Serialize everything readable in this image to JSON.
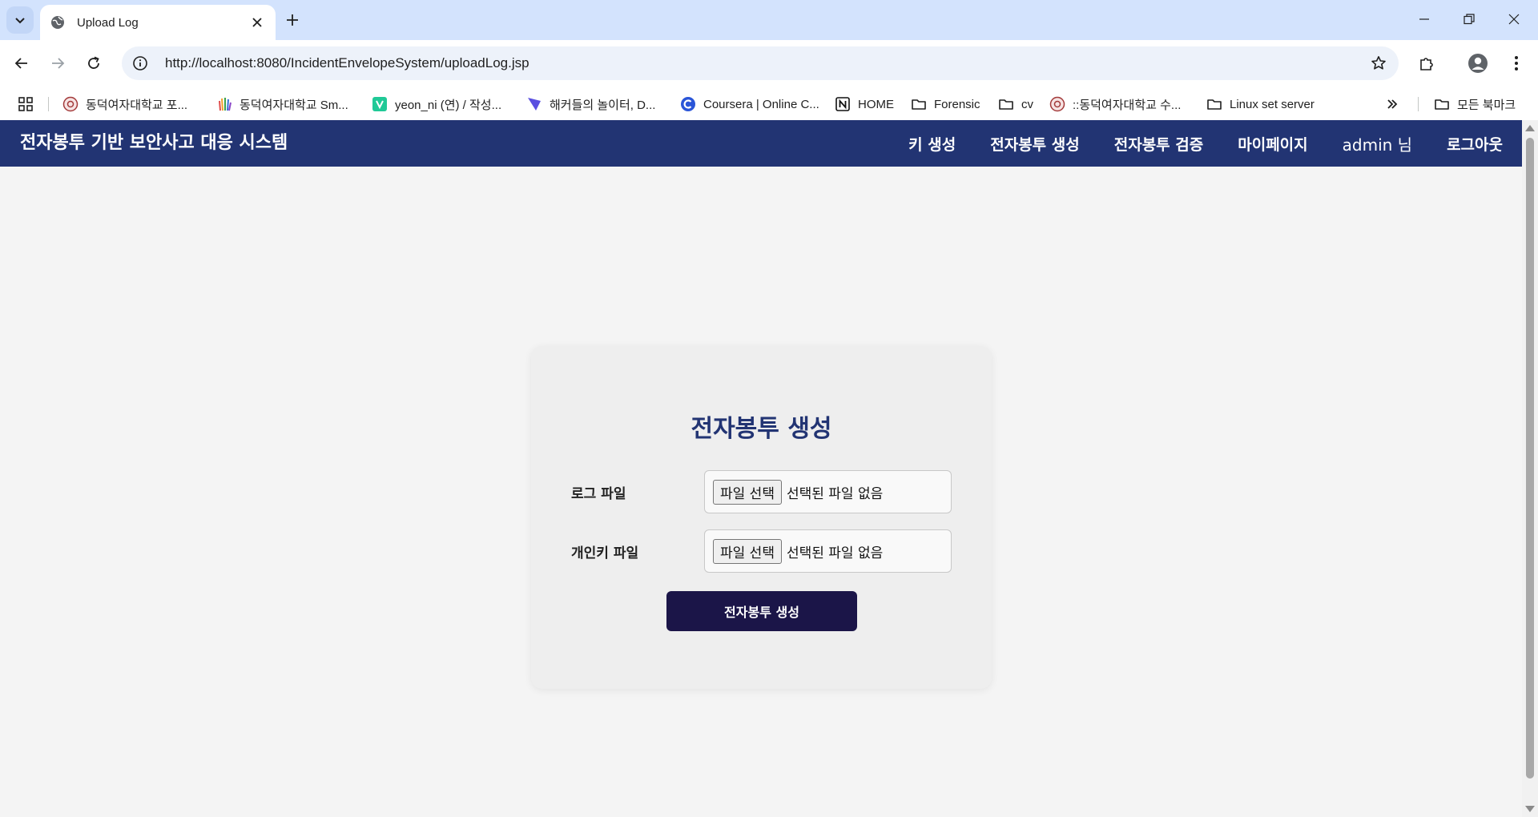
{
  "browser": {
    "tab_title": "Upload Log",
    "url": "http://localhost:8080/IncidentEnvelopeSystem/uploadLog.jsp",
    "bookmarks": [
      {
        "label": "동덕여자대학교 포...",
        "icon": "university-seal-icon"
      },
      {
        "label": "동덕여자대학교 Sm...",
        "icon": "hand-logo-icon"
      },
      {
        "label": "yeon_ni (연) / 작성...",
        "icon": "velog-icon"
      },
      {
        "label": "해커들의 놀이터, D...",
        "icon": "dreamhack-icon"
      },
      {
        "label": "Coursera | Online C...",
        "icon": "coursera-icon"
      },
      {
        "label": "HOME",
        "icon": "notion-icon"
      },
      {
        "label": "Forensic",
        "icon": "folder-icon"
      },
      {
        "label": "cv",
        "icon": "folder-icon"
      },
      {
        "label": "::동덕여자대학교 수...",
        "icon": "university-seal-icon"
      },
      {
        "label": "Linux set server",
        "icon": "folder-icon"
      }
    ],
    "all_bookmarks_label": "모든 북마크"
  },
  "app": {
    "brand": "전자봉투 기반 보안사고 대응 시스템",
    "nav": {
      "keygen": "키 생성",
      "create": "전자봉투 생성",
      "verify": "전자봉투 검증",
      "mypage": "마이페이지",
      "user": "admin 님",
      "logout": "로그아웃"
    }
  },
  "form": {
    "title": "전자봉투 생성",
    "log_label": "로그 파일",
    "key_label": "개인키 파일",
    "file_button": "파일 선택",
    "no_file": "선택된 파일 없음",
    "submit": "전자봉투 생성"
  },
  "colors": {
    "navbar": "#223473",
    "submit": "#1b1548",
    "tabstrip": "#d3e3fd"
  }
}
